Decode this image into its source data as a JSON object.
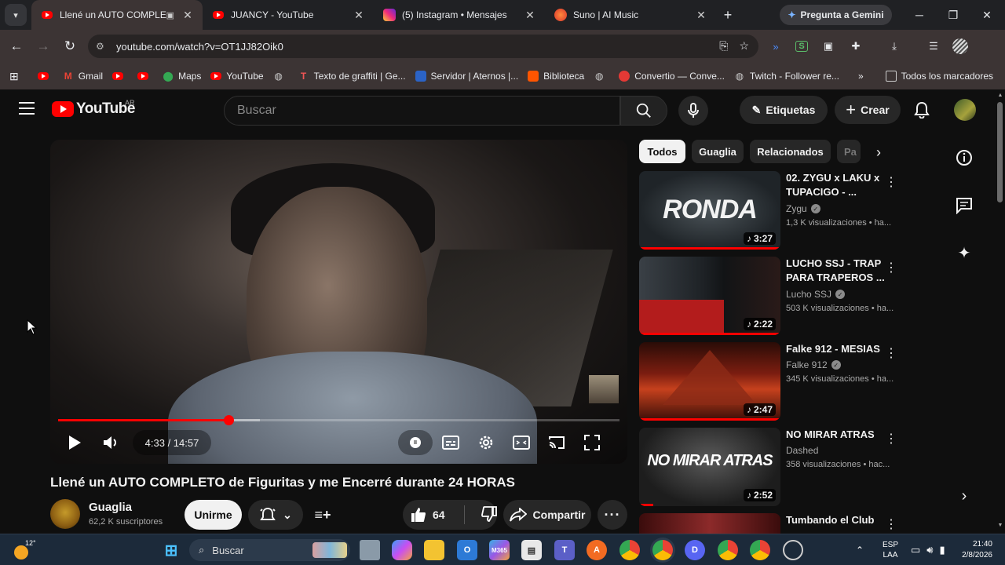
{
  "browser": {
    "tabs": [
      {
        "title": "Llené un AUTO COMPLETO",
        "active": true
      },
      {
        "title": "JUANCY - YouTube",
        "active": false
      },
      {
        "title": "(5) Instagram • Mensajes",
        "active": false
      },
      {
        "title": "Suno | AI Music",
        "active": false
      }
    ],
    "gemini_label": "Pregunta a Gemini",
    "url": "youtube.com/watch?v=OT1JJ82Oik0",
    "bookmarks": [
      "Gmail",
      "Maps",
      "YouTube",
      "Texto de graffiti | Ge...",
      "Servidor | Aternos |...",
      "Biblioteca",
      "Convertio — Conve...",
      "Twitch - Follower re..."
    ],
    "all_bookmarks_label": "Todos los marcadores"
  },
  "youtube": {
    "logo_text": "YouTube",
    "country_code": "AR",
    "search_placeholder": "Buscar",
    "tags_label": "Etiquetas",
    "create_label": "Crear"
  },
  "player": {
    "time": "4:33 / 14:57",
    "progress_fraction": 0.304,
    "loaded_fraction": 0.36
  },
  "video": {
    "title": "Llené un AUTO COMPLETO de Figuritas y me Encerré durante 24 HORAS",
    "channel": "Guaglia",
    "subscribers": "62,2 K suscriptores",
    "join_label": "Unirme",
    "likes": "64",
    "share_label": "Compartir"
  },
  "chips": [
    "Todos",
    "Guaglia",
    "Relacionados",
    "Pa"
  ],
  "recommendations": [
    {
      "title": "02. ZYGU x LAKU x TUPACIGO - ...",
      "channel": "Zygu",
      "views": "1,3 K visualizaciones • ha...",
      "duration": "3:27",
      "thumb_text": "RONDA",
      "watched_fraction": 1.0
    },
    {
      "title": "LUCHO SSJ - TRAP PARA TRAPEROS ...",
      "channel": "Lucho SSJ",
      "views": "503 K visualizaciones • ha...",
      "duration": "2:22",
      "thumb_text": "",
      "watched_fraction": 1.0
    },
    {
      "title": "Falke 912 - MESIAS",
      "channel": "Falke 912",
      "views": "345 K visualizaciones • ha...",
      "duration": "2:47",
      "thumb_text": "",
      "watched_fraction": 1.0
    },
    {
      "title": "NO MIRAR ATRAS",
      "channel": "Dashed",
      "views": "358 visualizaciones • hac...",
      "duration": "2:52",
      "thumb_text": "NO MIRAR ATRAS",
      "watched_fraction": 0.1
    },
    {
      "title": "Tumbando el Club",
      "channel": "",
      "views": "",
      "duration": "",
      "thumb_text": "",
      "watched_fraction": 0
    }
  ],
  "taskbar": {
    "weather": "12°",
    "search_label": "Buscar",
    "lang_top": "ESP",
    "lang_bottom": "LAA",
    "time": "21:40",
    "date": "2/8/2026"
  },
  "colors": {
    "accent": "#ff0000",
    "background": "#0f0f0f",
    "chrome_frame": "#3c3434"
  }
}
